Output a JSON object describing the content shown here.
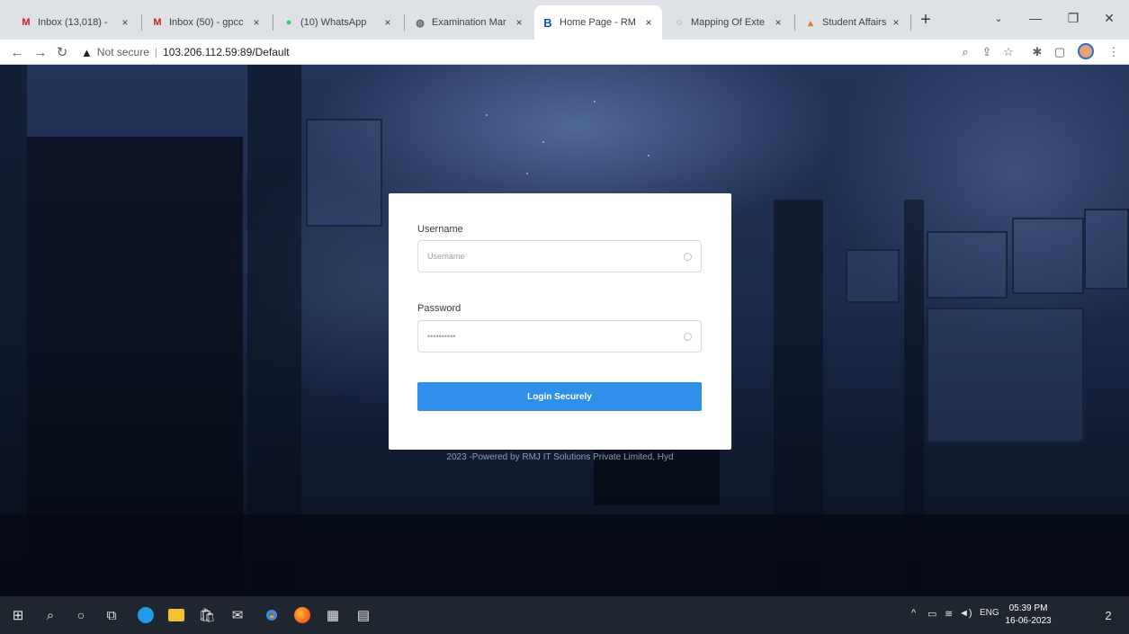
{
  "browser": {
    "tabs": [
      {
        "title": "Inbox (13,018) -",
        "icon": "gmail-icon",
        "color": "#c5221f",
        "glyph": "M"
      },
      {
        "title": "Inbox (50) - gpcc",
        "icon": "gmail-icon",
        "color": "#c5221f",
        "glyph": "M"
      },
      {
        "title": "(10) WhatsApp",
        "icon": "whatsapp-icon",
        "color": "#25d366",
        "glyph": "●"
      },
      {
        "title": "Examination Mar",
        "icon": "globe-icon",
        "color": "#5f6368",
        "glyph": "◍"
      },
      {
        "title": "Home Page - RM",
        "icon": "b-logo-icon",
        "color": "#1a4fc4",
        "glyph": "B"
      },
      {
        "title": "Mapping Of Exte",
        "icon": "loading-icon",
        "color": "#5f6368",
        "glyph": "◌"
      },
      {
        "title": "Student Affairs",
        "icon": "student-affairs-icon",
        "color": "#e07a2e",
        "glyph": "▴"
      }
    ],
    "active_tab": 4,
    "address": {
      "security_label": "Not secure",
      "url": "103.206.112.59:89/Default"
    }
  },
  "login": {
    "username_label": "Username",
    "username_placeholder": "Username",
    "password_label": "Password",
    "password_placeholder": "••••••••••",
    "button_label": "Login Securely"
  },
  "footer": {
    "text": "2023 -Powered by RMJ IT Solutions Private Limited, Hyd"
  },
  "taskbar": {
    "language": "ENG",
    "time": "05:39 PM",
    "date": "16-06-2023",
    "notification_count": "2"
  },
  "colors": {
    "accent": "#2f8fe9",
    "page_background": "#1b2a4a",
    "taskbar": "#1f2630"
  }
}
